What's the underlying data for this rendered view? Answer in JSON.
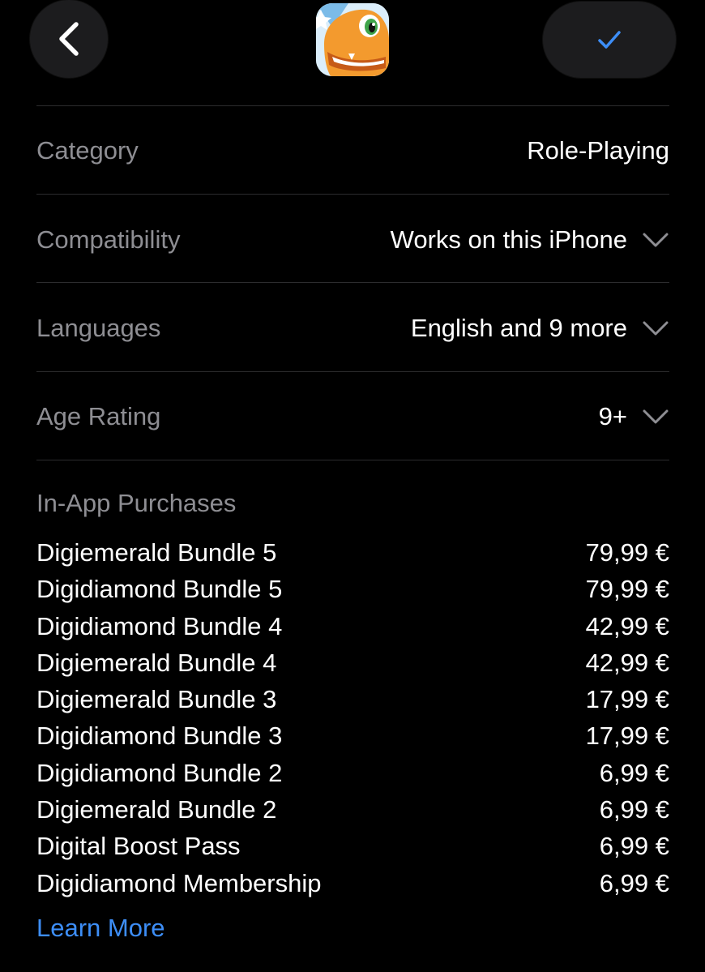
{
  "nav": {
    "back_icon": "chevron-left-icon",
    "app_icon": "agumon-app-icon",
    "done_icon": "checkmark-icon",
    "accent": "#3d8ef7"
  },
  "info_rows": [
    {
      "label": "Category",
      "value": "Role-Playing",
      "expandable": false
    },
    {
      "label": "Compatibility",
      "value": "Works on this iPhone",
      "expandable": true
    },
    {
      "label": "Languages",
      "value": "English and 9 more",
      "expandable": true
    },
    {
      "label": "Age Rating",
      "value": "9+",
      "expandable": true
    }
  ],
  "in_app_purchases": {
    "title": "In-App Purchases",
    "items": [
      {
        "name": "Digiemerald Bundle 5",
        "price": "79,99 €"
      },
      {
        "name": "Digidiamond Bundle 5",
        "price": "79,99 €"
      },
      {
        "name": "Digidiamond Bundle 4",
        "price": "42,99 €"
      },
      {
        "name": "Digiemerald Bundle 4",
        "price": "42,99 €"
      },
      {
        "name": "Digiemerald Bundle 3",
        "price": "17,99 €"
      },
      {
        "name": "Digidiamond Bundle 3",
        "price": "17,99 €"
      },
      {
        "name": "Digidiamond Bundle 2",
        "price": "6,99 €"
      },
      {
        "name": "Digiemerald Bundle 2",
        "price": "6,99 €"
      },
      {
        "name": "Digital Boost Pass",
        "price": "6,99 €"
      },
      {
        "name": "Digidiamond Membership",
        "price": "6,99 €"
      }
    ],
    "learn_more": "Learn More"
  }
}
